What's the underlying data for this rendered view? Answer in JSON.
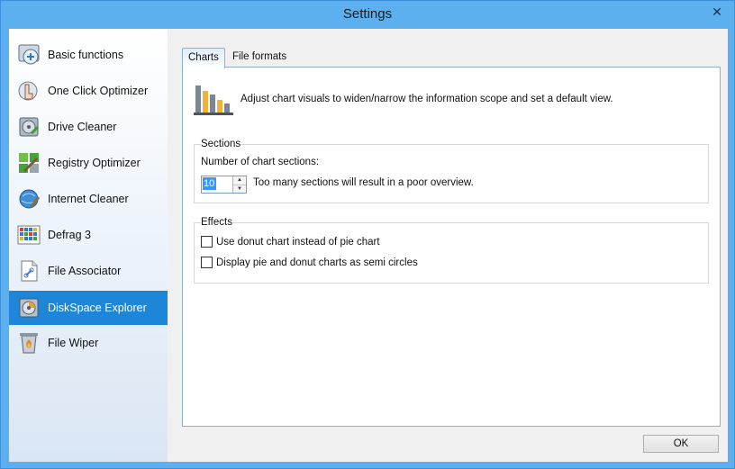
{
  "window": {
    "title": "Settings",
    "close_glyph": "✕"
  },
  "sidebar": {
    "items": [
      {
        "label": "Basic functions",
        "icon": "basic-functions-icon",
        "active": false
      },
      {
        "label": "One Click Optimizer",
        "icon": "one-click-optimizer-icon",
        "active": false
      },
      {
        "label": "Drive Cleaner",
        "icon": "drive-cleaner-icon",
        "active": false
      },
      {
        "label": "Registry Optimizer",
        "icon": "registry-optimizer-icon",
        "active": false
      },
      {
        "label": "Internet Cleaner",
        "icon": "internet-cleaner-icon",
        "active": false
      },
      {
        "label": "Defrag 3",
        "icon": "defrag-icon",
        "active": false
      },
      {
        "label": "File Associator",
        "icon": "file-associator-icon",
        "active": false
      },
      {
        "label": "DiskSpace Explorer",
        "icon": "diskspace-explorer-icon",
        "active": true
      },
      {
        "label": "File Wiper",
        "icon": "file-wiper-icon",
        "active": false
      }
    ]
  },
  "tabs": [
    {
      "label": "Charts",
      "active": true
    },
    {
      "label": "File formats",
      "active": false
    }
  ],
  "charts": {
    "description": "Adjust chart visuals to widen/narrow the information scope and set a default view.",
    "sections": {
      "group_label": "Sections",
      "count_label": "Number of chart sections:",
      "count_value": "10",
      "hint": "Too many sections will result in a poor overview."
    },
    "effects": {
      "group_label": "Effects",
      "donut_label": "Use donut chart instead of pie chart",
      "donut_checked": false,
      "semicircle_label": "Display pie and donut charts as semi circles",
      "semicircle_checked": false
    }
  },
  "buttons": {
    "ok_label": "OK"
  },
  "colors": {
    "titlebar": "#5cb0ef",
    "active_item": "#1e86d8",
    "panel_border": "#8fb0d3"
  }
}
